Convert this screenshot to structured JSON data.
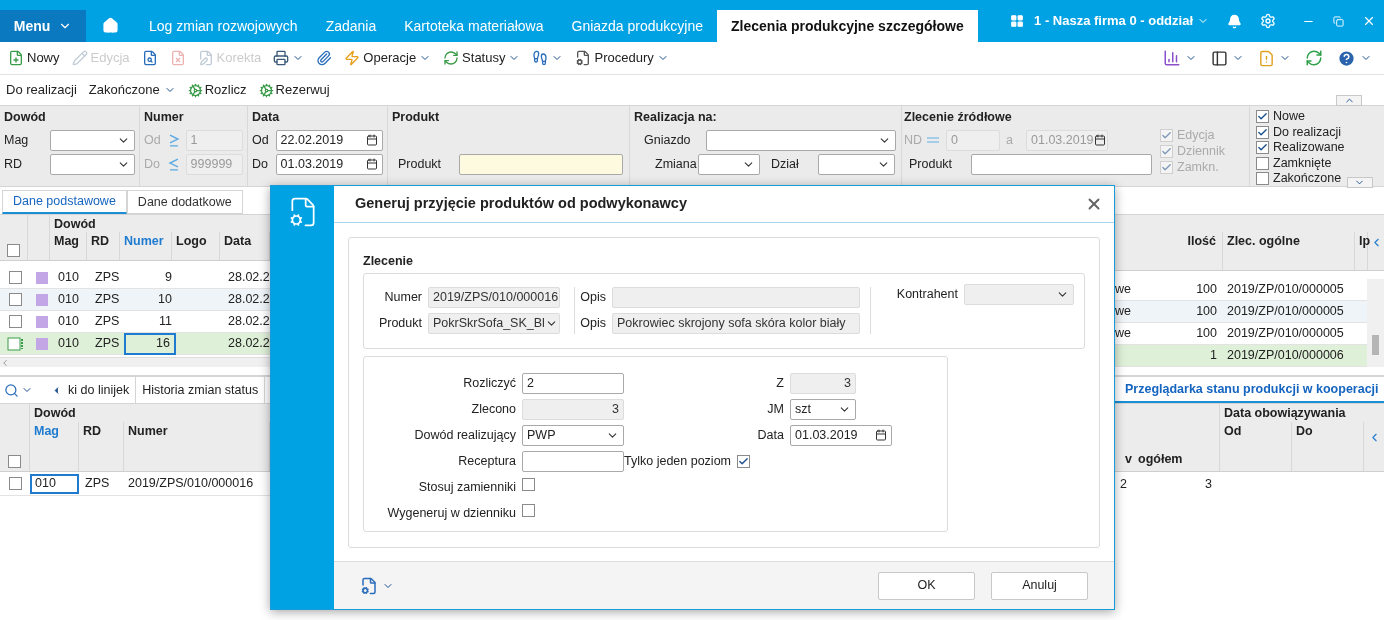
{
  "top_bar": {
    "menu": "Menu",
    "tabs": [
      {
        "label": "Log zmian rozwojowych",
        "selected": false
      },
      {
        "label": "Zadania",
        "selected": false
      },
      {
        "label": "Kartoteka materiałowa",
        "selected": false
      },
      {
        "label": "Gniazda produkcyjne",
        "selected": false
      },
      {
        "label": "Zlecenia produkcyjne szczegółowe",
        "selected": true
      }
    ],
    "company": "1 - Nasza firma 0 - oddział"
  },
  "toolbar": [
    {
      "kind": "new",
      "label": "Nowy",
      "disabled": false,
      "dropdown": false
    },
    {
      "kind": "edit",
      "label": "Edycja",
      "disabled": true,
      "dropdown": false
    },
    {
      "kind": "preview",
      "disabled": false,
      "dropdown": false
    },
    {
      "kind": "delete",
      "disabled": true,
      "dropdown": false
    },
    {
      "kind": "correct",
      "label": "Korekta",
      "disabled": true,
      "dropdown": false
    },
    {
      "kind": "print",
      "disabled": false,
      "dropdown": true
    },
    {
      "kind": "attach",
      "disabled": false,
      "dropdown": false
    },
    {
      "kind": "operations",
      "label": "Operacje",
      "disabled": false,
      "dropdown": true
    },
    {
      "kind": "statuses",
      "label": "Statusy",
      "disabled": false,
      "dropdown": true
    },
    {
      "kind": "steps",
      "disabled": false,
      "dropdown": true
    },
    {
      "kind": "procedures",
      "label": "Procedury",
      "disabled": false,
      "dropdown": true
    }
  ],
  "toolbar2": [
    {
      "kind": "text",
      "label": "Do realizacji"
    },
    {
      "kind": "dropdown",
      "label": "Zakończone"
    },
    {
      "kind": "action",
      "label": "Rozlicz"
    },
    {
      "kind": "action",
      "label": "Rezerwuj"
    }
  ],
  "filters": {
    "dowod": {
      "title": "Dowód",
      "mag": "Mag",
      "rd": "RD"
    },
    "numer": {
      "title": "Numer",
      "od": "Od",
      "od_value": "1",
      "do": "Do",
      "do_value": "999999",
      "disabled": true
    },
    "data": {
      "title": "Data",
      "od": "Od",
      "od_value": "22.02.2019",
      "do": "Do",
      "do_value": "01.03.2019"
    },
    "produkt": {
      "title": "Produkt",
      "label": "Produkt"
    },
    "realizacja": {
      "title": "Realizacja na:",
      "gniazdo": "Gniazdo",
      "zmiana": "Zmiana",
      "dzial": "Dział"
    },
    "zrodlowe": {
      "title": "Zlecenie źródłowe",
      "nd": "ND",
      "nd_value": "0",
      "a": "a",
      "date": "01.03.2019",
      "produkt": "Produkt",
      "checks": [
        {
          "label": "Edycja",
          "checked": true,
          "disabled": true
        },
        {
          "label": "Dziennik",
          "checked": true,
          "disabled": true
        },
        {
          "label": "Zamkn.",
          "checked": true,
          "disabled": true
        }
      ]
    },
    "statuses": [
      {
        "label": "Nowe",
        "checked": true
      },
      {
        "label": "Do realizacji",
        "checked": true
      },
      {
        "label": "Realizowane",
        "checked": true
      },
      {
        "label": "Zamknięte",
        "checked": false
      },
      {
        "label": "Zakończone",
        "checked": false
      }
    ]
  },
  "main_tabs": [
    {
      "label": "Dane podstawowe",
      "selected": true
    },
    {
      "label": "Dane dodatkowe",
      "selected": false
    }
  ],
  "table": {
    "select_all_checked": false,
    "group": "Dowód",
    "columns": [
      {
        "label": "Mag",
        "sorted": false
      },
      {
        "label": "RD",
        "sorted": false
      },
      {
        "label": "Numer",
        "sorted": true
      },
      {
        "label": "Logo",
        "sorted": false
      },
      {
        "label": "Data",
        "sorted": false
      }
    ],
    "right_columns": [
      {
        "label": "Ilość"
      },
      {
        "label": "Zlec. ogólne"
      },
      {
        "label": "Ip"
      }
    ],
    "rows": [
      {
        "color": "#c3a6e6",
        "mag": "010",
        "rd": "ZPS",
        "numer": "9",
        "data": "28.02.2",
        "column_1": "we",
        "ilosc": "100",
        "zlec": "2019/ZP/010/000005",
        "selected": false,
        "checked": false
      },
      {
        "color": "#c3a6e6",
        "mag": "010",
        "rd": "ZPS",
        "numer": "10",
        "data": "28.02.2",
        "column_1": "we",
        "ilosc": "100",
        "zlec": "2019/ZP/010/000005",
        "selected": false,
        "checked": false
      },
      {
        "color": "#c3a6e6",
        "mag": "010",
        "rd": "ZPS",
        "numer": "11",
        "data": "28.02.2",
        "column_1": "we",
        "ilosc": "100",
        "zlec": "2019/ZP/010/000005",
        "selected": false,
        "checked": false
      },
      {
        "color": "#c3a6e6",
        "mag": "010",
        "rd": "ZPS",
        "numer": "16",
        "data": "28.02.2",
        "ilosc": "1",
        "zlec": "2019/ZP/010/000006",
        "selected": true,
        "checked": false
      }
    ]
  },
  "lower": {
    "tabs": [
      {
        "label": "ki do linijek",
        "selected": false
      },
      {
        "label": "Historia zmian status",
        "selected": false
      },
      {
        "label": "Przeglądarka stanu produkcji w kooperacji",
        "selected": true
      }
    ],
    "select_all_checked": false,
    "group": "Dowód",
    "columns": [
      {
        "label": "Mag",
        "sorted": true
      },
      {
        "label": "RD",
        "sorted": false
      },
      {
        "label": "Numer",
        "sorted": false
      }
    ],
    "right_group": "Data obowiązywania",
    "right_columns": [
      "Od",
      "Do"
    ],
    "sub_columns": [
      "v",
      "ogółem"
    ],
    "rows": [
      {
        "mag": "010",
        "rd": "ZPS",
        "numer": "2019/ZPS/010/000016",
        "column_1": "2",
        "column_2": "3",
        "checked": false
      }
    ]
  },
  "dialog": {
    "title": "Generuj przyjęcie produktów od podwykonawcy",
    "section": "Zlecenie",
    "numer_label": "Numer",
    "numer": "2019/ZPS/010/000016",
    "produkt_label": "Produkt",
    "produkt": "PokrSkrSofa_SK_Bl",
    "opis_label": "Opis",
    "opis2_label": "Opis",
    "opis2": "Pokrowiec skrojony sofa skóra kolor biały",
    "kontrahent_label": "Kontrahent",
    "left": [
      {
        "kind": "text",
        "label": "Rozliczyć",
        "value": "2"
      },
      {
        "kind": "readonly",
        "label": "Zlecono",
        "value": "3"
      },
      {
        "kind": "select",
        "label": "Dowód realizujący",
        "value": "PWP"
      },
      {
        "kind": "text",
        "label": "Receptura"
      },
      {
        "kind": "check",
        "label": "Stosuj zamienniki",
        "checked": false
      },
      {
        "kind": "check",
        "label": "Wygeneruj w dzienniku",
        "checked": false
      }
    ],
    "right": [
      {
        "kind": "readonly",
        "label": "Z",
        "value": "3"
      },
      {
        "kind": "select",
        "label": "JM",
        "value": "szt"
      },
      {
        "kind": "date",
        "label": "Data",
        "value": "01.03.2019"
      },
      {
        "kind": "check",
        "label": "Tylko jeden poziom",
        "checked": true
      }
    ],
    "buttons": [
      "OK",
      "Anuluj"
    ]
  }
}
